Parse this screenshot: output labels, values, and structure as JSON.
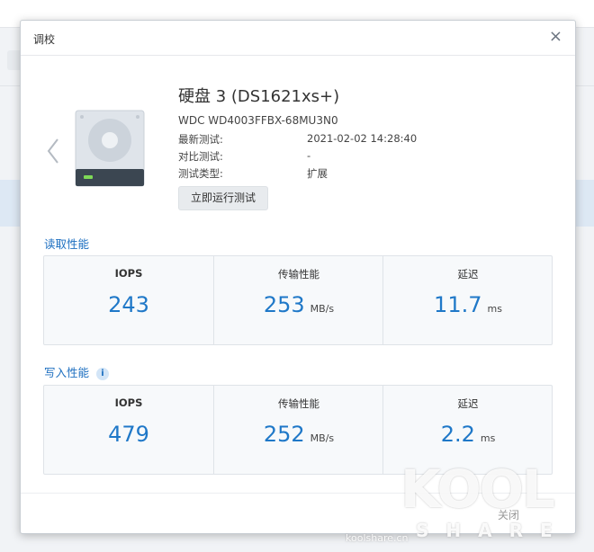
{
  "dialog": {
    "title": "调校",
    "close_symbol": "×"
  },
  "disk": {
    "name": "硬盘 3 (DS1621xs+)",
    "model": "WDC WD4003FFBX-68MU3N0",
    "info": [
      {
        "label": "最新测试:",
        "value": "2021-02-02 14:28:40"
      },
      {
        "label": "对比测试:",
        "value": "-"
      },
      {
        "label": "测试类型:",
        "value": "扩展"
      }
    ],
    "run_button": "立即运行测试"
  },
  "read": {
    "title": "读取性能",
    "iops": {
      "label": "IOPS",
      "value": "243"
    },
    "throughput": {
      "label": "传输性能",
      "value": "253",
      "unit": "MB/s"
    },
    "latency": {
      "label": "延迟",
      "value": "11.7",
      "unit": "ms"
    }
  },
  "write": {
    "title": "写入性能",
    "info_badge": "i",
    "iops": {
      "label": "IOPS",
      "value": "479"
    },
    "throughput": {
      "label": "传输性能",
      "value": "252",
      "unit": "MB/s"
    },
    "latency": {
      "label": "延迟",
      "value": "2.2",
      "unit": "ms"
    }
  },
  "footer": {
    "close_button": "关闭"
  },
  "watermark": {
    "brand": "KOOL",
    "sub": "SHARE",
    "url": "koolshare.cn"
  },
  "colors": {
    "accent": "#1f78c8",
    "panel_bg": "#f7f9fb"
  },
  "icons": {
    "prev": "chevron-left-icon",
    "disk": "hard-drive-icon",
    "close": "close-icon",
    "info": "info-icon"
  }
}
